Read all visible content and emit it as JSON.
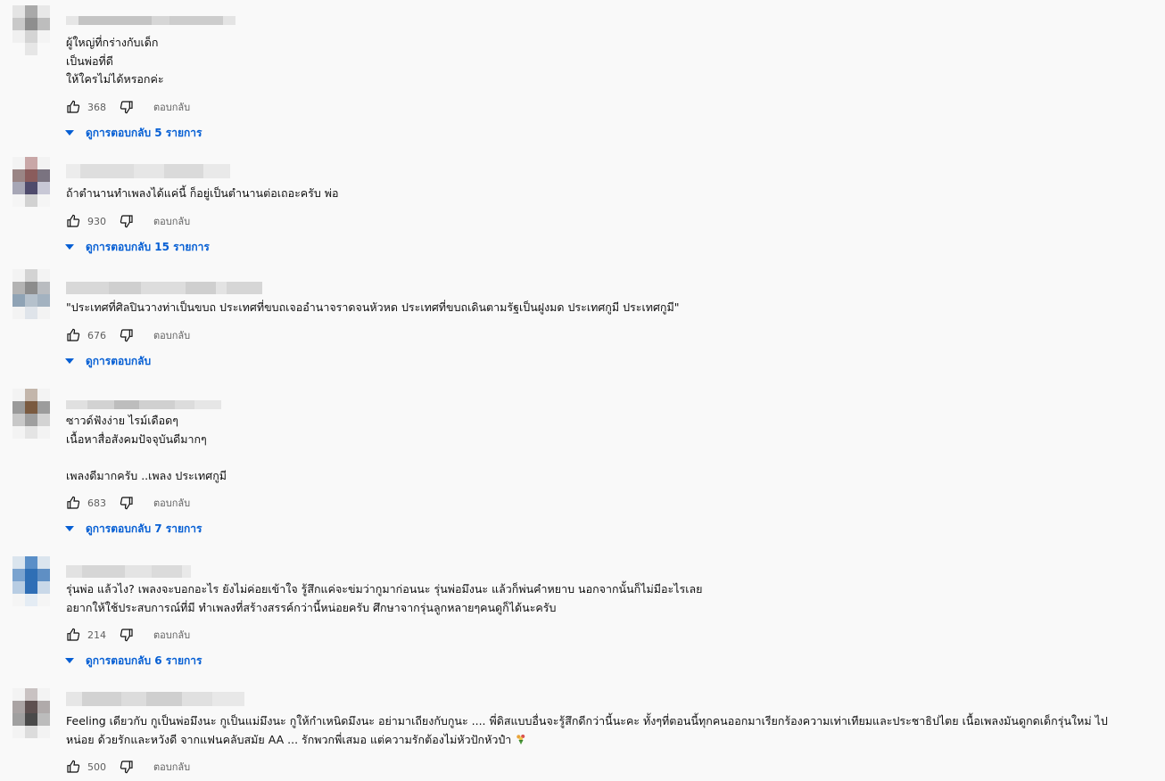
{
  "comments": [
    {
      "lines": [
        "ผู้ใหญ่ที่กร่างกับเด็ก",
        "เป็นพ่อที่ดี",
        "ให้ใครไม่ได้หรอกค่ะ"
      ],
      "likes": "368",
      "reply_label": "ตอบกลับ",
      "replies_label": "ดูการตอบกลับ 5 รายการ"
    },
    {
      "lines": [
        "ถ้าตำนานทำเพลงได้แค่นี้ ก็อยู่เป็นตำนานต่อเถอะครับ พ่อ"
      ],
      "likes": "930",
      "reply_label": "ตอบกลับ",
      "replies_label": "ดูการตอบกลับ 15 รายการ"
    },
    {
      "lines": [
        "\"ประเทศที่ศิลปินวางท่าเป็นขบถ ประเทศที่ขบถเจออำนาจราดจนหัวหด ประเทศที่ขบถเดินตามรัฐเป็นฝูงมด ประเทศกูมี ประเทศกูมี\""
      ],
      "likes": "676",
      "reply_label": "ตอบกลับ",
      "replies_label": "ดูการตอบกลับ"
    },
    {
      "lines": [
        "ซาวด์ฟังง่าย ไรม์เดือดๆ",
        "เนื้อหาสื่อสังคมปัจจุบันดีมากๆ",
        "",
        "เพลงดีมากครับ ..เพลง ประเทศกูมี"
      ],
      "likes": "683",
      "reply_label": "ตอบกลับ",
      "replies_label": "ดูการตอบกลับ 7 รายการ"
    },
    {
      "lines": [
        "รุ่นพ่อ แล้วไง? เพลงจะบอกอะไร ยังไม่ค่อยเข้าใจ รู้สึกแค่จะข่มว่ากูมาก่อนนะ รุ่นพ่อมึงนะ แล้วก็พ่นคำหยาบ นอกจากนั้นก็ไม่มีอะไรเลย",
        "อยากให้ใช้ประสบการณ์ที่มี ทำเพลงที่สร้างสรรค์กว่านี้หน่อยครับ ศึกษาจากรุ่นลูกหลายๆคนดูก็ได้นะครับ"
      ],
      "likes": "214",
      "reply_label": "ตอบกลับ",
      "replies_label": "ดูการตอบกลับ 6 รายการ"
    },
    {
      "lines": [
        "Feeling เดียวกับ กูเป็นพ่อมึงนะ กูเป็นแม่มึงนะ กูให้กำเหนิดมึงนะ อย่ามาเถียงกับกูนะ .... พี่ดิสแบบอื่นจะรู้สึกดีกว่านี้นะคะ ทั้งๆที่ตอนนี้ทุกคนออกมาเรียกร้องความเท่าเทียมและประชาธิปไตย เนื้อเพลงมันดูกดเด็กรุ่นใหม่ ไป",
        "หน่อย ด้วยรักและหวังดี จากแฟนคลับสมัย AA ... รักพวกพี่เสมอ แต่ความรักต้องไม่หัวปักหัวปำ"
      ],
      "likes": "500",
      "reply_label": "ตอบกลับ",
      "emoji": "bouquet-icon"
    }
  ],
  "colors": {
    "link": "#065fd4",
    "muted": "#606060",
    "text": "#0f0f0f"
  }
}
